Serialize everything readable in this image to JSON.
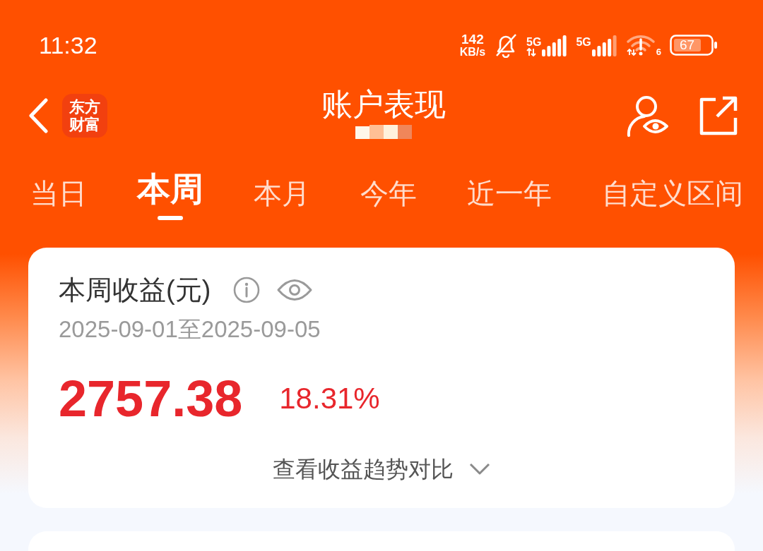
{
  "status_bar": {
    "time": "11:32",
    "network_speed": {
      "value": "142",
      "unit": "KB/s"
    },
    "sim_cards": [
      {
        "label": "5G"
      },
      {
        "label": "5G"
      }
    ],
    "wifi_label": "6",
    "battery": "67"
  },
  "header": {
    "logo": "东方财富",
    "title": "账户表现"
  },
  "tabs": [
    {
      "label": "当日",
      "selected": false
    },
    {
      "label": "本周",
      "selected": true
    },
    {
      "label": "本月",
      "selected": false
    },
    {
      "label": "今年",
      "selected": false
    },
    {
      "label": "近一年",
      "selected": false
    },
    {
      "label": "自定义区间",
      "selected": false
    }
  ],
  "card": {
    "title": "本周收益(元)",
    "date_range": "2025-09-01至2025-09-05",
    "amount": "2757.38",
    "rate": "18.31%",
    "trend_link": "查看收益趋势对比"
  }
}
